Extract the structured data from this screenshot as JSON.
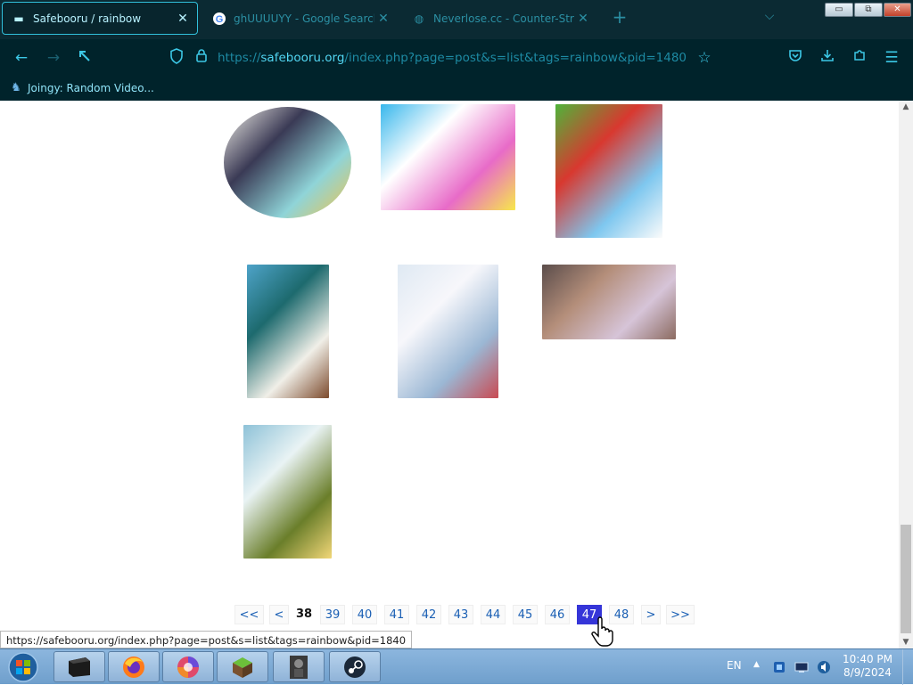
{
  "browser": {
    "tabs": [
      {
        "title": "Safebooru / rainbow",
        "active": true
      },
      {
        "title": "ghUUUUYY - Google Search",
        "active": false
      },
      {
        "title": "Neverlose.cc - Counter-Strike",
        "active": false
      }
    ],
    "window_controls": {
      "minimize": "▭",
      "maximize": "⧉",
      "close": "✕"
    },
    "nav": {
      "back": "←",
      "forward": "→",
      "reload": "⟲"
    },
    "url": {
      "scheme": "https://",
      "domain": "safebooru.org",
      "path": "/index.php?page=post&s=list&tags=rainbow&pid=1480"
    },
    "bookmark": {
      "label": "Joingy: Random Video..."
    },
    "status_url": "https://safebooru.org/index.php?page=post&s=list&tags=rainbow&pid=1840"
  },
  "page": {
    "thumbnails": [
      {
        "name": "thumb-anime-girl-pencils",
        "colors": [
          "#f5f2ea",
          "#3a3a55",
          "#8fd4d8",
          "#f0c44a"
        ]
      },
      {
        "name": "thumb-rainbow-character",
        "colors": [
          "#38b7ec",
          "#ffffff",
          "#e86bc8",
          "#f7e84a"
        ]
      },
      {
        "name": "thumb-yoshi-mario-christmas",
        "colors": [
          "#4fb43a",
          "#d8382f",
          "#7ec7ef",
          "#fbfbfb"
        ]
      },
      {
        "name": "thumb-green-hooded-bard",
        "colors": [
          "#4ea3c9",
          "#1d6a6e",
          "#f0efe8",
          "#7c4a2c"
        ]
      },
      {
        "name": "thumb-girl-in-snow",
        "colors": [
          "#dfe9f3",
          "#f7f7fb",
          "#9bb7d4",
          "#c94a52"
        ]
      },
      {
        "name": "thumb-two-girls-city",
        "colors": [
          "#5b4d4b",
          "#b48e7a",
          "#d6c4d8",
          "#8b6a60"
        ]
      },
      {
        "name": "thumb-gardevoir-field",
        "colors": [
          "#8ec2d8",
          "#e9f3f4",
          "#6a7e2a",
          "#f2d778"
        ]
      }
    ],
    "pagination": {
      "first": "<<",
      "prev": "<",
      "pages": [
        "38",
        "39",
        "40",
        "41",
        "42",
        "43",
        "44",
        "45",
        "46",
        "47",
        "48"
      ],
      "current": "38",
      "highlighted": "47",
      "next": ">",
      "last": ">>"
    }
  },
  "taskbar": {
    "apps": [
      "terminal",
      "firefox",
      "browser",
      "minecraft",
      "game",
      "steam"
    ],
    "language": "EN",
    "time": "10:40 PM",
    "date": "8/9/2024"
  },
  "colors": {
    "chrome_bg": "#00232b",
    "accent": "#31c1dc",
    "link": "#1a5fb4",
    "highlight": "#3535d8"
  }
}
